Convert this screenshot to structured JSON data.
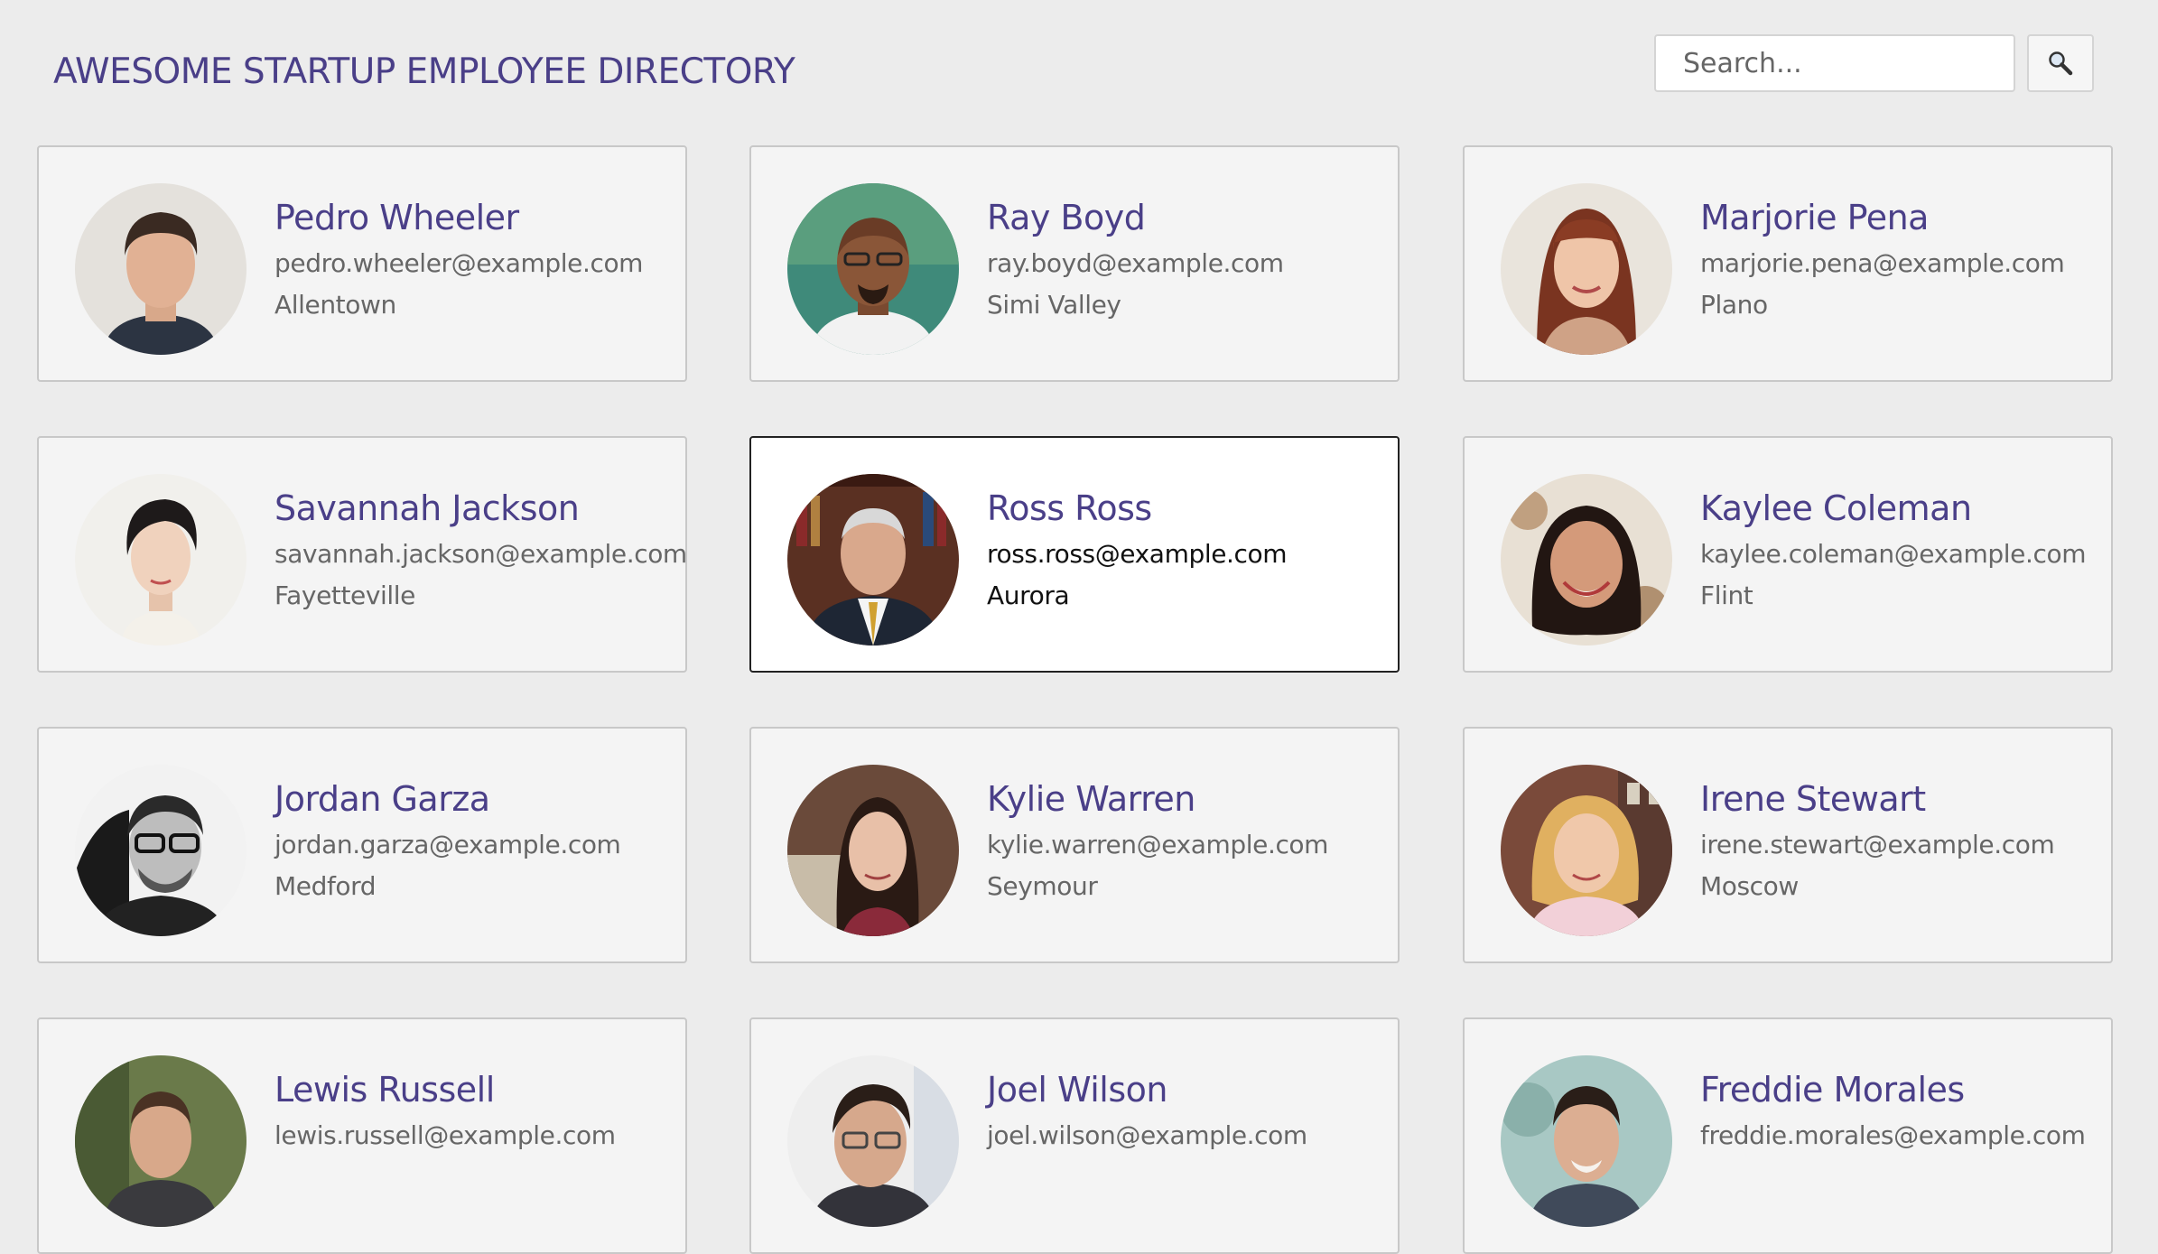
{
  "header": {
    "title": "AWESOME STARTUP EMPLOYEE DIRECTORY"
  },
  "search": {
    "placeholder": "Search...",
    "value": "",
    "button_icon": "magnifier-icon"
  },
  "colors": {
    "accent": "#4a3f88",
    "background": "#ececec",
    "card": "#f4f4f4",
    "card_active": "#ffffff"
  },
  "employees": [
    {
      "name": "Pedro Wheeler",
      "email": "pedro.wheeler@example.com",
      "city": "Allentown",
      "active": false
    },
    {
      "name": "Ray Boyd",
      "email": "ray.boyd@example.com",
      "city": "Simi Valley",
      "active": false
    },
    {
      "name": "Marjorie Pena",
      "email": "marjorie.pena@example.com",
      "city": "Plano",
      "active": false
    },
    {
      "name": "Savannah Jackson",
      "email": "savannah.jackson@example.com",
      "city": "Fayetteville",
      "active": false
    },
    {
      "name": "Ross Ross",
      "email": "ross.ross@example.com",
      "city": "Aurora",
      "active": true
    },
    {
      "name": "Kaylee Coleman",
      "email": "kaylee.coleman@example.com",
      "city": "Flint",
      "active": false
    },
    {
      "name": "Jordan Garza",
      "email": "jordan.garza@example.com",
      "city": "Medford",
      "active": false
    },
    {
      "name": "Kylie Warren",
      "email": "kylie.warren@example.com",
      "city": "Seymour",
      "active": false
    },
    {
      "name": "Irene Stewart",
      "email": "irene.stewart@example.com",
      "city": "Moscow",
      "active": false
    },
    {
      "name": "Lewis Russell",
      "email": "lewis.russell@example.com",
      "city": "",
      "active": false
    },
    {
      "name": "Joel Wilson",
      "email": "joel.wilson@example.com",
      "city": "",
      "active": false
    },
    {
      "name": "Freddie Morales",
      "email": "freddie.morales@example.com",
      "city": "",
      "active": false
    }
  ]
}
